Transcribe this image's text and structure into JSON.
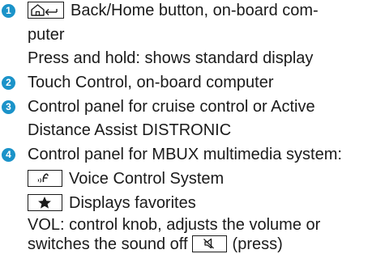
{
  "legend": {
    "items": [
      {
        "number": "1",
        "lines": {
          "l1_text": "Back/Home button, on-board com-",
          "l2_text": "puter",
          "l3_text": "Press and hold: shows standard display"
        },
        "icon": "home-back-key-icon"
      },
      {
        "number": "2",
        "text": "Touch Control, on-board computer"
      },
      {
        "number": "3",
        "lines": {
          "l1_text": "Control panel for cruise control or Active",
          "l2_text": "Distance Assist DISTRONIC"
        }
      },
      {
        "number": "4",
        "lines": {
          "l1_text": "Control panel for MBUX multimedia system:",
          "voice_text": "Voice Control System",
          "favorites_text": "Displays favorites",
          "vol_text_1": "VOL: control knob, adjusts the volume or",
          "vol_text_2a": "switches the sound off",
          "vol_text_2b": "(press)"
        },
        "icons": [
          "voice-control-key-icon",
          "star-key-icon",
          "mute-key-icon"
        ]
      }
    ]
  },
  "colors": {
    "badge": "#1b93c9",
    "text": "#1a1a1a"
  }
}
